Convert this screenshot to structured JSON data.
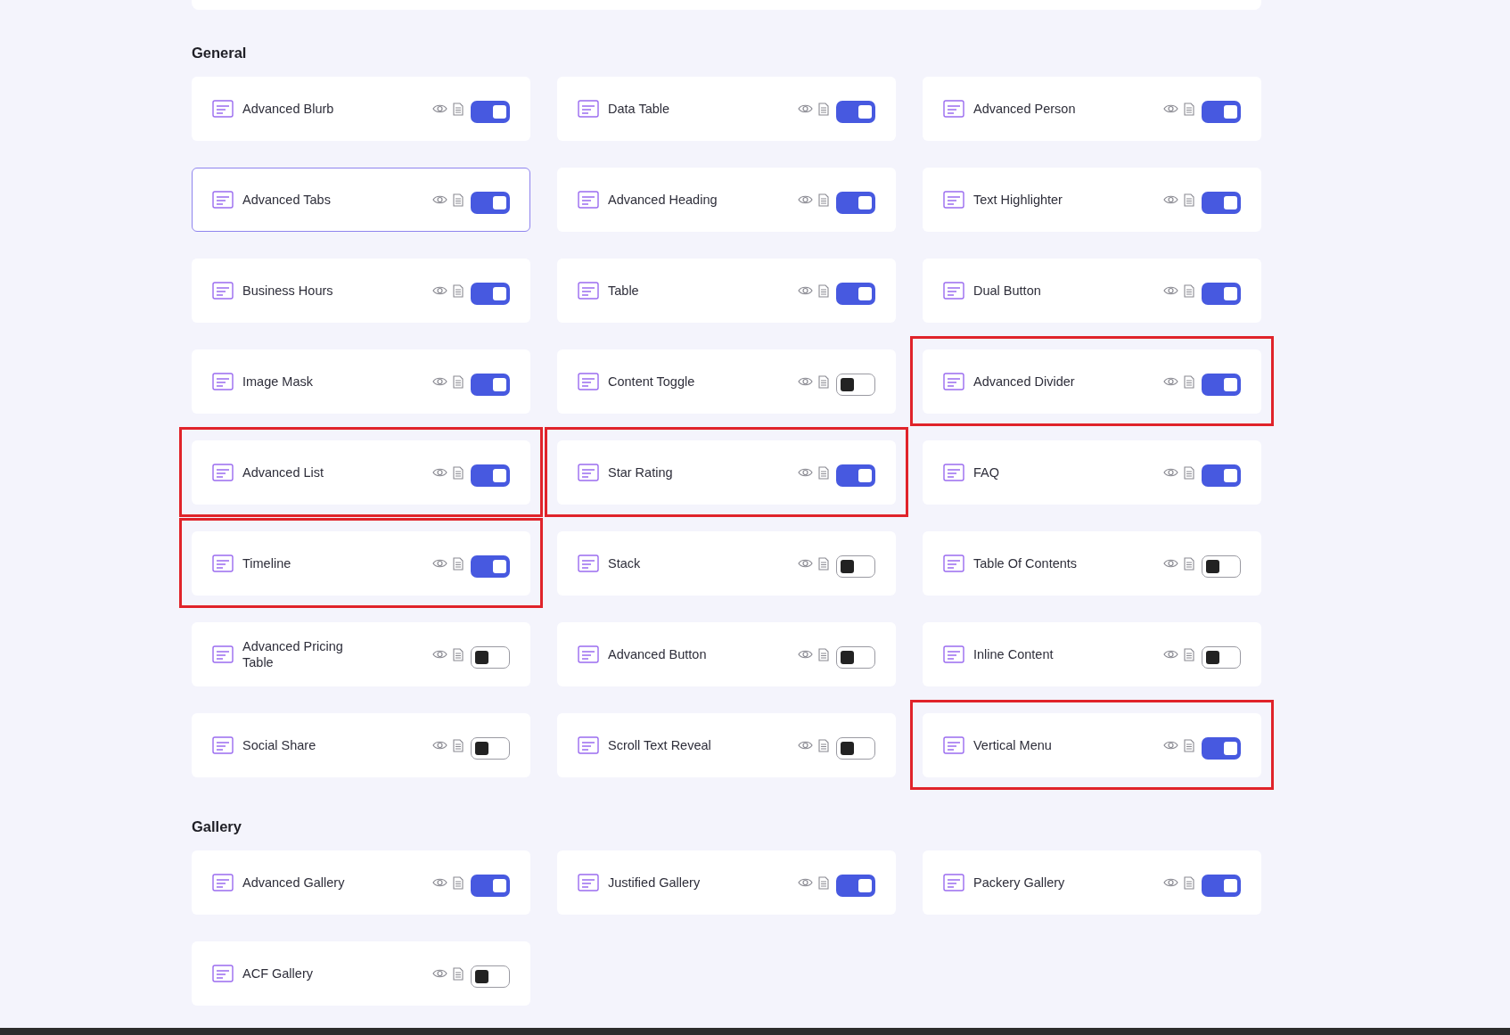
{
  "sections": [
    {
      "title": "General",
      "widgets": [
        {
          "name": "Advanced Blurb",
          "enabled": true,
          "focused": false,
          "highlighted": false
        },
        {
          "name": "Data Table",
          "enabled": true,
          "focused": false,
          "highlighted": false
        },
        {
          "name": "Advanced Person",
          "enabled": true,
          "focused": false,
          "highlighted": false
        },
        {
          "name": "Advanced Tabs",
          "enabled": true,
          "focused": true,
          "highlighted": false
        },
        {
          "name": "Advanced Heading",
          "enabled": true,
          "focused": false,
          "highlighted": false
        },
        {
          "name": "Text Highlighter",
          "enabled": true,
          "focused": false,
          "highlighted": false
        },
        {
          "name": "Business Hours",
          "enabled": true,
          "focused": false,
          "highlighted": false
        },
        {
          "name": "Table",
          "enabled": true,
          "focused": false,
          "highlighted": false
        },
        {
          "name": "Dual Button",
          "enabled": true,
          "focused": false,
          "highlighted": false
        },
        {
          "name": "Image Mask",
          "enabled": true,
          "focused": false,
          "highlighted": false
        },
        {
          "name": "Content Toggle",
          "enabled": false,
          "focused": false,
          "highlighted": false
        },
        {
          "name": "Advanced Divider",
          "enabled": true,
          "focused": false,
          "highlighted": true
        },
        {
          "name": "Advanced List",
          "enabled": true,
          "focused": false,
          "highlighted": true
        },
        {
          "name": "Star Rating",
          "enabled": true,
          "focused": false,
          "highlighted": true
        },
        {
          "name": "FAQ",
          "enabled": true,
          "focused": false,
          "highlighted": false
        },
        {
          "name": "Timeline",
          "enabled": true,
          "focused": false,
          "highlighted": true
        },
        {
          "name": "Stack",
          "enabled": false,
          "focused": false,
          "highlighted": false
        },
        {
          "name": "Table Of Contents",
          "enabled": false,
          "focused": false,
          "highlighted": false
        },
        {
          "name": "Advanced Pricing Table",
          "enabled": false,
          "focused": false,
          "highlighted": false
        },
        {
          "name": "Advanced Button",
          "enabled": false,
          "focused": false,
          "highlighted": false
        },
        {
          "name": "Inline Content",
          "enabled": false,
          "focused": false,
          "highlighted": false
        },
        {
          "name": "Social Share",
          "enabled": false,
          "focused": false,
          "highlighted": false
        },
        {
          "name": "Scroll Text Reveal",
          "enabled": false,
          "focused": false,
          "highlighted": false
        },
        {
          "name": "Vertical Menu",
          "enabled": true,
          "focused": false,
          "highlighted": true
        }
      ]
    },
    {
      "title": "Gallery",
      "widgets": [
        {
          "name": "Advanced Gallery",
          "enabled": true,
          "focused": false,
          "highlighted": false
        },
        {
          "name": "Justified Gallery",
          "enabled": true,
          "focused": false,
          "highlighted": false
        },
        {
          "name": "Packery Gallery",
          "enabled": true,
          "focused": false,
          "highlighted": false
        },
        {
          "name": "ACF Gallery",
          "enabled": false,
          "focused": false,
          "highlighted": false
        }
      ]
    }
  ]
}
